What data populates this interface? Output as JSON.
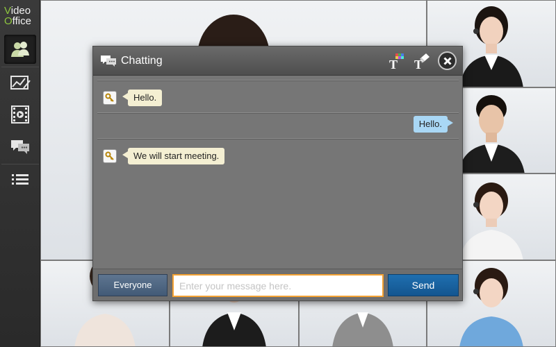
{
  "app": {
    "logo_line1": "Video",
    "logo_line2": "Office",
    "brand_color": "#8ec63f"
  },
  "sidebar": {
    "items": [
      {
        "name": "participants",
        "icon": "participants-icon",
        "active": true
      },
      {
        "name": "whiteboard",
        "icon": "whiteboard-icon",
        "active": false
      },
      {
        "name": "video-share",
        "icon": "video-play-icon",
        "active": false
      },
      {
        "name": "chat",
        "icon": "chat-bubbles-icon",
        "active": false
      },
      {
        "name": "menu",
        "icon": "list-menu-icon",
        "active": false
      }
    ]
  },
  "chat": {
    "title": "Chatting",
    "header_icons": [
      "chat-bubbles-icon",
      "text-color-icon",
      "text-eraser-icon",
      "close-icon"
    ],
    "messages": [
      {
        "direction": "incoming",
        "text": "Hello."
      },
      {
        "direction": "outgoing",
        "text": "Hello."
      },
      {
        "direction": "incoming",
        "text": "We will start meeting."
      }
    ],
    "recipient_button": "Everyone",
    "input_placeholder": "Enter your message here.",
    "input_value": "",
    "send_button": "Send",
    "colors": {
      "incoming_bubble": "#f4efd2",
      "outgoing_bubble": "#a9d7f5",
      "input_focus_border": "#f4a232",
      "send_button": "#1f6fb0",
      "everyone_button": "#5e7590"
    }
  }
}
